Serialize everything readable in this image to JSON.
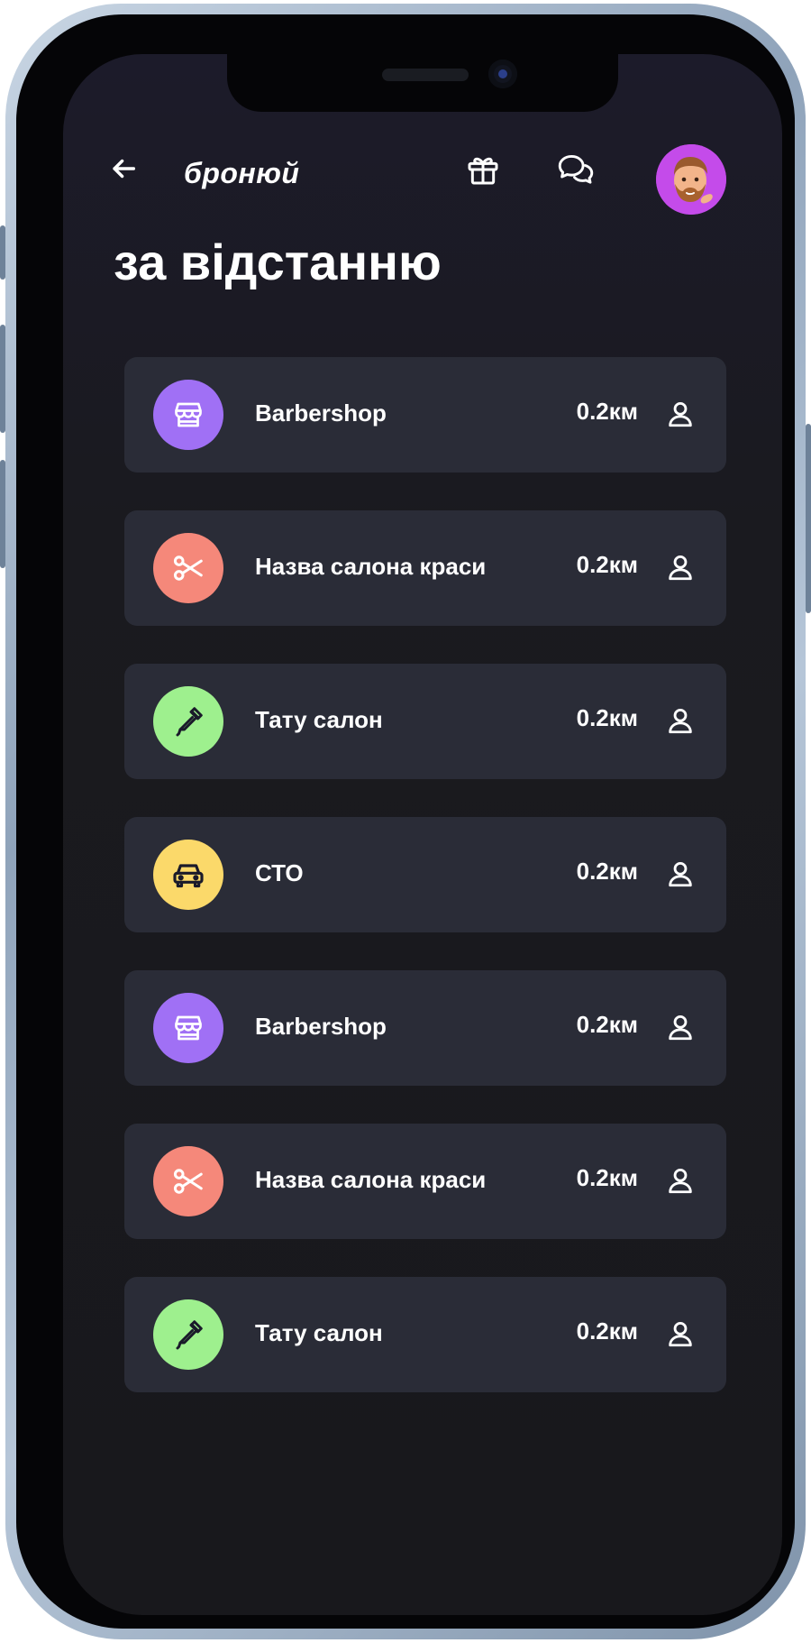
{
  "app": {
    "brand": "бронюй"
  },
  "header": {
    "back_icon": "arrow-left-icon",
    "gift_icon": "gift-icon",
    "chat_icon": "chat-bubbles-icon",
    "avatar_icon": "memoji-avatar",
    "avatar_bg": "#c44bea"
  },
  "page": {
    "title": "за відстанню"
  },
  "list": {
    "items": [
      {
        "name": "Barbershop",
        "distance": "0.2км",
        "icon": "storefront-icon",
        "color": "#a070f5"
      },
      {
        "name": "Назва салона краси",
        "distance": "0.2км",
        "icon": "scissors-icon",
        "color": "#f5887a"
      },
      {
        "name": "Тату салон",
        "distance": "0.2км",
        "icon": "dropper-icon",
        "color": "#9ef08e"
      },
      {
        "name": "СТО",
        "distance": "0.2км",
        "icon": "car-icon",
        "color": "#fbd96a"
      },
      {
        "name": "Barbershop",
        "distance": "0.2км",
        "icon": "storefront-icon",
        "color": "#a070f5"
      },
      {
        "name": "Назва салона краси",
        "distance": "0.2км",
        "icon": "scissors-icon",
        "color": "#f5887a"
      },
      {
        "name": "Тату салон",
        "distance": "0.2км",
        "icon": "dropper-icon",
        "color": "#9ef08e"
      }
    ]
  },
  "colors": {
    "background": "#1a1a1f",
    "card": "#2a2c37",
    "text": "#ffffff"
  }
}
